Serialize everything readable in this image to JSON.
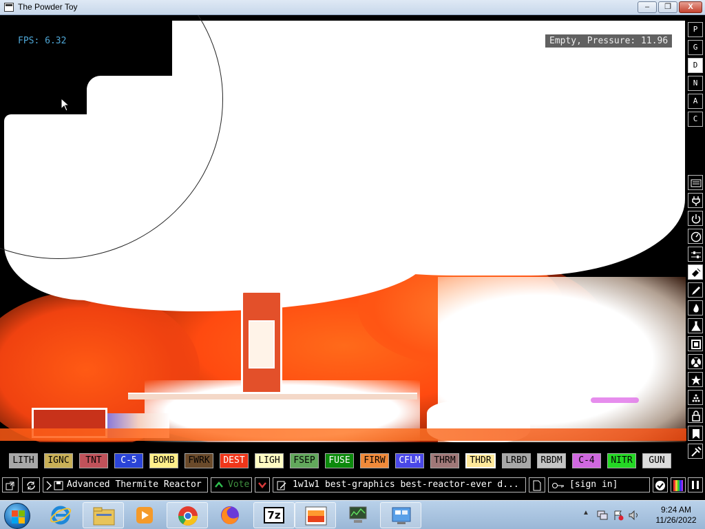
{
  "window": {
    "title": "The Powder Toy",
    "min_label": "–",
    "max_label": "❐",
    "close_label": "X"
  },
  "canvas": {
    "fps": "FPS: 6.32",
    "status": "Empty, Pressure: 11.96"
  },
  "sidebar": {
    "top_buttons": [
      "P",
      "G",
      "D",
      "N",
      "A",
      "C"
    ],
    "active_index": 2,
    "icon_buttons": [
      "keyboard-icon",
      "plug-icon",
      "power-icon",
      "gauge-icon",
      "sliders-icon",
      "spray-icon",
      "brush-icon",
      "flame-icon",
      "flask-icon",
      "square-icon",
      "radiation-icon",
      "star-icon",
      "dots-icon",
      "lock-icon",
      "bookmark-icon",
      "tools-icon"
    ],
    "active_icon": "spray-icon"
  },
  "elements": [
    {
      "label": "LITH",
      "bg": "#a8a8a8",
      "fg": "#000000"
    },
    {
      "label": "IGNC",
      "bg": "#c9b057",
      "fg": "#000000"
    },
    {
      "label": "TNT",
      "bg": "#c0525a",
      "fg": "#000000"
    },
    {
      "label": "C-5",
      "bg": "#2a44d8",
      "fg": "#ffffff"
    },
    {
      "label": "BOMB",
      "bg": "#ffef8a",
      "fg": "#000000"
    },
    {
      "label": "FWRK",
      "bg": "#6a4a2a",
      "fg": "#000000"
    },
    {
      "label": "DEST",
      "bg": "#f0361a",
      "fg": "#ffffff"
    },
    {
      "label": "LIGH",
      "bg": "#fffbc4",
      "fg": "#000000"
    },
    {
      "label": "FSEP",
      "bg": "#62a85c",
      "fg": "#000000"
    },
    {
      "label": "FUSE",
      "bg": "#0c8a0c",
      "fg": "#ffffff"
    },
    {
      "label": "FIRW",
      "bg": "#f08a3a",
      "fg": "#000000"
    },
    {
      "label": "CFLM",
      "bg": "#4a48e8",
      "fg": "#ffffff"
    },
    {
      "label": "THRM",
      "bg": "#a07878",
      "fg": "#000000"
    },
    {
      "label": "THDR",
      "bg": "#ffe89a",
      "fg": "#000000"
    },
    {
      "label": "LRBD",
      "bg": "#a8a8a8",
      "fg": "#000000"
    },
    {
      "label": "RBDM",
      "bg": "#c4c4c4",
      "fg": "#000000"
    },
    {
      "label": "C-4",
      "bg": "#d068e0",
      "fg": "#000000"
    },
    {
      "label": "NITR",
      "bg": "#24d824",
      "fg": "#000000"
    },
    {
      "label": "GUN",
      "bg": "#dcdcdc",
      "fg": "#000000"
    }
  ],
  "selected_element": "THDR",
  "bottom": {
    "save_name": "Advanced Thermite Reactor",
    "vote_label": "Vote",
    "tags": "1w1w1 best-graphics best-reactor-ever d...",
    "sign_in": "[sign in]"
  },
  "taskbar": {
    "apps": [
      "internet-explorer-icon",
      "file-explorer-icon",
      "media-player-icon",
      "chrome-icon",
      "firefox-icon",
      "7zip-icon",
      "powder-toy-icon",
      "network-monitor-icon",
      "control-panel-icon"
    ],
    "seven_zip_label": "7z",
    "time": "9:24 AM",
    "date": "11/26/2022"
  }
}
